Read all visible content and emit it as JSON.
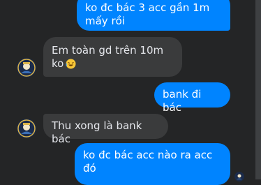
{
  "messages": [
    {
      "direction": "outgoing",
      "text": "ko đc bác 3 acc gần 1m mấy rồi"
    },
    {
      "direction": "incoming",
      "text": "Em toàn gd trên 10m ko",
      "emoji": "laughing-emoji"
    },
    {
      "direction": "outgoing",
      "text": "bank đi bác"
    },
    {
      "direction": "incoming",
      "text": "Thu xong là bank bác"
    },
    {
      "direction": "outgoing",
      "text": "ko đc bác acc nào ra acc đó"
    }
  ],
  "colors": {
    "background": "#242526",
    "outgoing_bubble": "#0084ff",
    "incoming_bubble": "#3a3b3c",
    "text_incoming": "#e4e6eb",
    "text_outgoing": "#ffffff"
  },
  "icons": {
    "avatar": "contact-avatar-icon",
    "seen": "seen-avatar-icon"
  }
}
